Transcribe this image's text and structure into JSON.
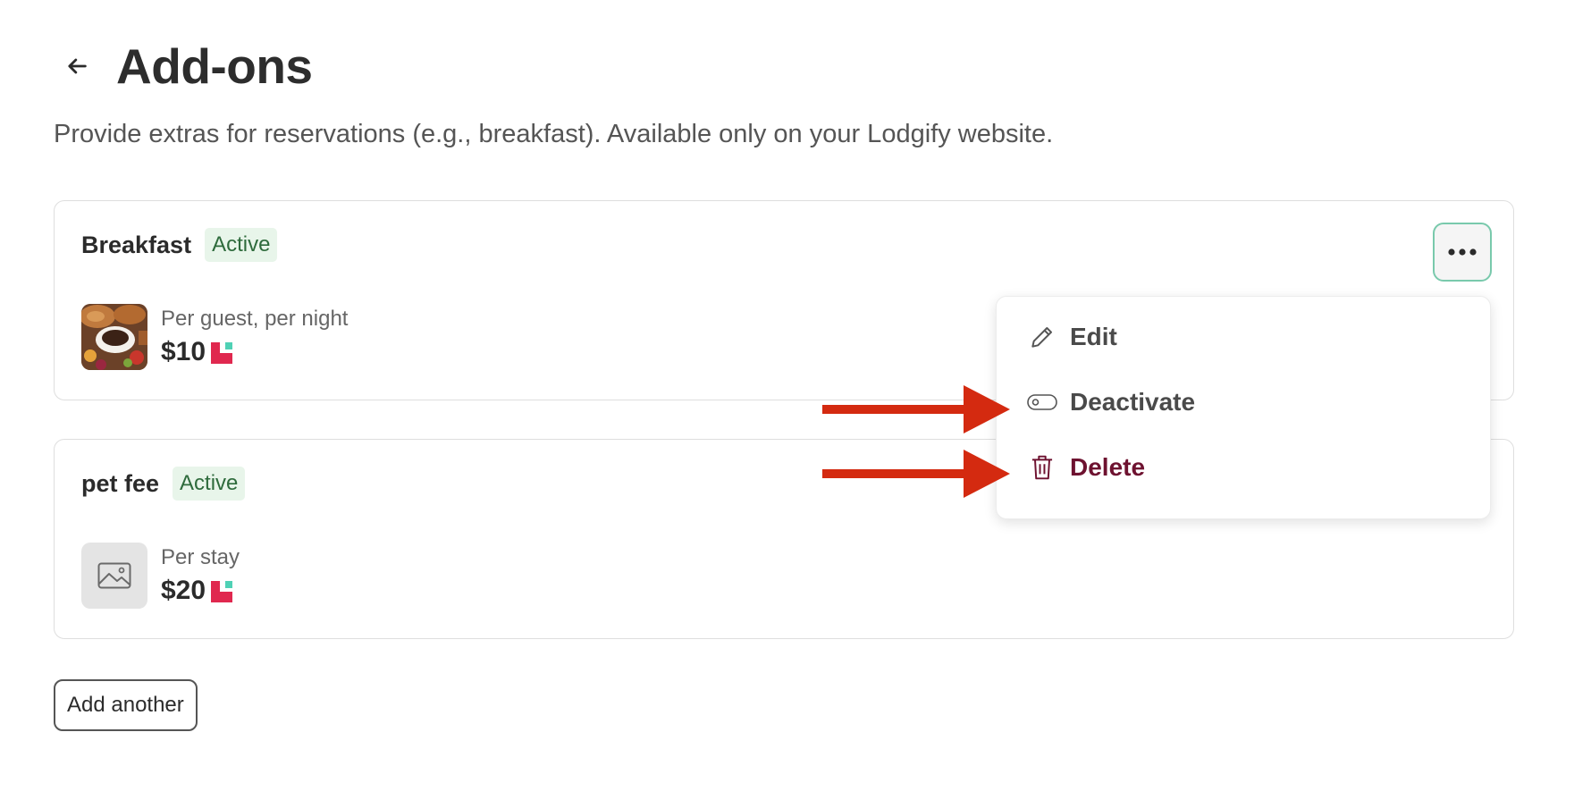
{
  "page": {
    "title": "Add-ons",
    "subtitle": "Provide extras for reservations (e.g., breakfast). Available only on your Lodgify website."
  },
  "icons": {
    "back": "arrow-left-icon",
    "more": "more-horizontal-icon",
    "edit": "pencil-icon",
    "deactivate": "toggle-off-icon",
    "delete": "trash-icon",
    "placeholder": "image-placeholder-icon",
    "price_indicator": "lodgify-mark-icon"
  },
  "addons": [
    {
      "name": "Breakfast",
      "status": "Active",
      "rate": "Per guest, per night",
      "price": "$10",
      "has_photo": true
    },
    {
      "name": "pet fee",
      "status": "Active",
      "rate": "Per stay",
      "price": "$20",
      "has_photo": false
    }
  ],
  "menu": {
    "items": [
      {
        "label": "Edit",
        "icon": "pencil-icon"
      },
      {
        "label": "Deactivate",
        "icon": "toggle-off-icon"
      },
      {
        "label": "Delete",
        "icon": "trash-icon"
      }
    ]
  },
  "annotations": {
    "arrow_color": "#d42a10",
    "targets": [
      "Deactivate",
      "Delete"
    ]
  },
  "actions": {
    "add_another": "Add another"
  },
  "colors": {
    "active_badge_bg": "#e8f5ea",
    "active_badge_text": "#2e6b3c",
    "focus_ring": "#79c9ac",
    "delete_text": "#6e1230",
    "brand_red": "#e0284f",
    "brand_teal": "#4fd1b5"
  }
}
